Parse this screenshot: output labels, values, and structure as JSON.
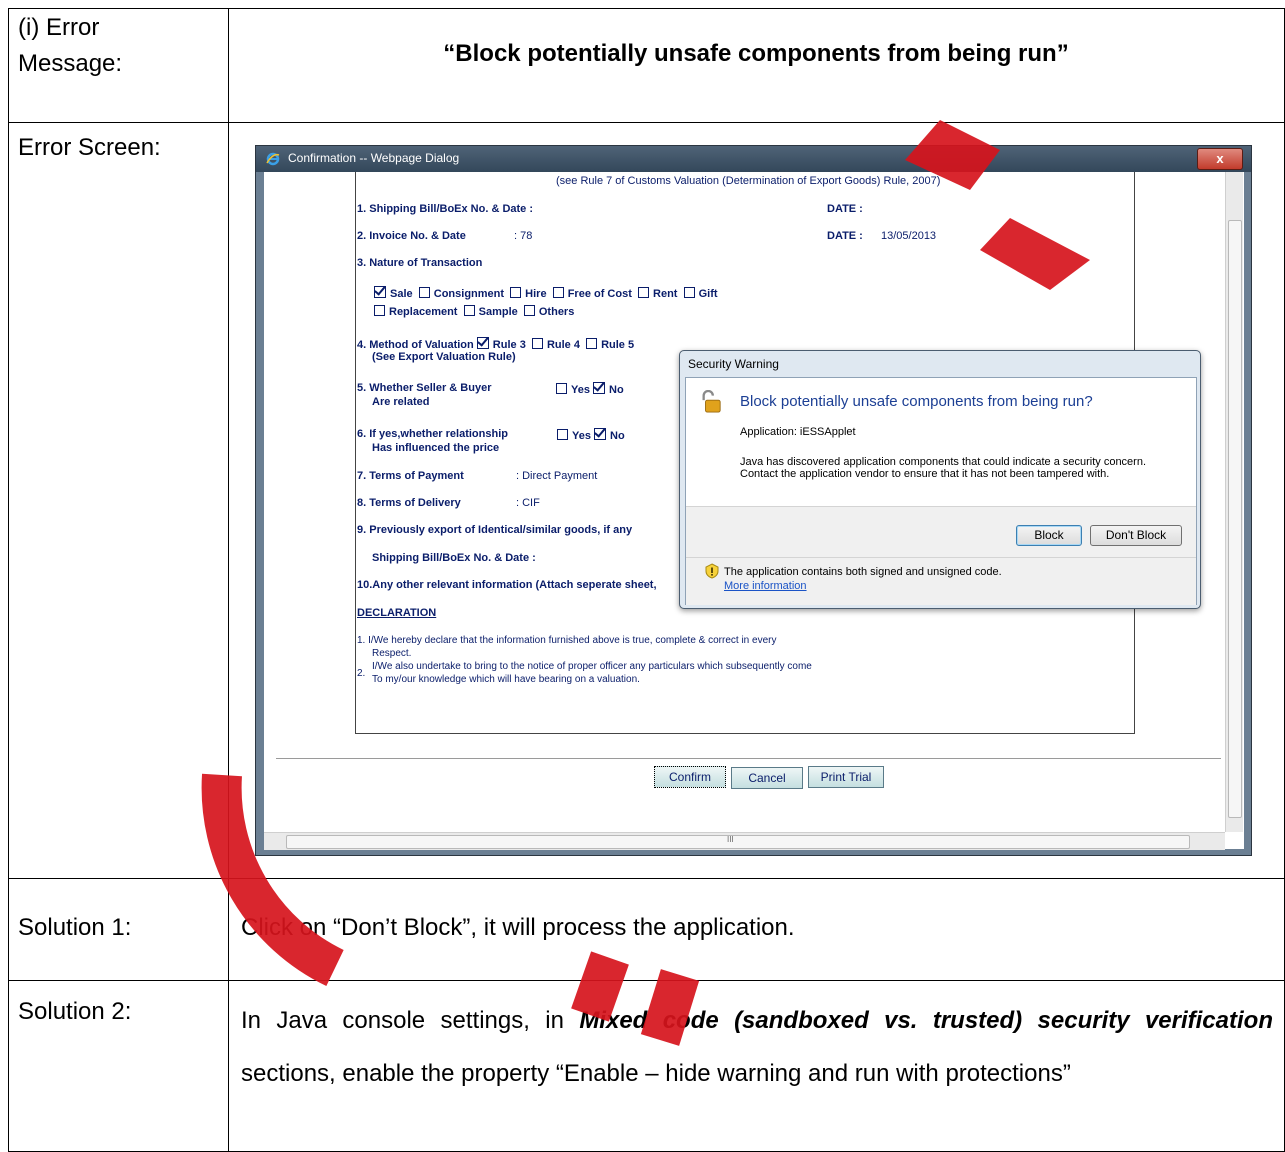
{
  "row1": {
    "label": "(i) Error Message:",
    "message": "“Block potentially unsafe components from being run”"
  },
  "row2": {
    "label": "Error Screen:"
  },
  "row3": {
    "label": "Solution 1:",
    "text": "Click on “Don’t Block”, it will process the application."
  },
  "row4": {
    "label": "Solution 2:",
    "text_pre": "In Java console settings, in ",
    "text_bold": "Mixed code (sandboxed vs. trusted) security verification",
    "text_post": " sections, enable the property “Enable – hide warning and run with protections”"
  },
  "window": {
    "title": "Confirmation -- Webpage Dialog",
    "close_label": "x",
    "close_icon": "close-icon",
    "browser_icon": "internet-explorer-icon"
  },
  "form": {
    "rule_header": "(see Rule 7 of Customs Valuation (Determination of Export Goods) Rule, 2007)",
    "item1": "1. Shipping Bill/BoEx No. & Date  :",
    "item1_date": "DATE :",
    "item2": "2. Invoice No. & Date",
    "item2_value": ": 78",
    "item2_date": "DATE :",
    "item2_date_value": "13/05/2013",
    "item3": "3. Nature of Transaction",
    "opt_sale": "Sale",
    "opt_consignment": "Consignment",
    "opt_hire": "Hire",
    "opt_free": "Free of Cost",
    "opt_rent": "Rent",
    "opt_gift": "Gift",
    "opt_replacement": "Replacement",
    "opt_sample": "Sample",
    "opt_others": "Others",
    "item4": "4. Method of Valuation",
    "rule3": "Rule 3",
    "rule4": "Rule 4",
    "rule5": "Rule 5",
    "item4_sub": "(See Export Valuation Rule)",
    "item5_line1": "5. Whether Seller & Buyer",
    "item5_line2": "Are related",
    "yes": "Yes",
    "no": "No",
    "item6_line1": "6. If yes,whether relationship",
    "item6_line2": "Has influenced the price",
    "item7": "7. Terms of Payment",
    "item7_value": ": Direct Payment",
    "item8": "8. Terms of Delivery",
    "item8_value": ": CIF",
    "item9": "9. Previously export of Identical/similar goods, if any",
    "item9_sub": "Shipping Bill/BoEx No. & Date :",
    "item10": "10.Any other relevant information (Attach seperate sheet,",
    "declaration": "DECLARATION",
    "decl1_line1": "1.  I/We hereby declare that the information furnished above is true, complete & correct in every",
    "decl1_line2": "Respect.",
    "decl2_line1": "I/We also undertake to bring to the notice of proper officer any particulars which subsequently come",
    "decl2_num": "2.",
    "decl2_line2": "To my/our knowledge which will have bearing on a valuation.",
    "confirm": "Confirm",
    "cancel": "Cancel",
    "print": "Print Trial",
    "hscroll_mark": "III"
  },
  "dialog": {
    "title": "Security Warning",
    "heading": "Block potentially unsafe components from being run?",
    "application": "Application: iESSApplet",
    "body": "Java has discovered application components that could indicate a security concern. Contact the application vendor to ensure that it has not been tampered with.",
    "block": "Block",
    "dont_block": "Don't Block",
    "warning": "The application contains both signed and unsigned code.",
    "more_info": "More information",
    "lock_icon": "unlocked-padlock-icon",
    "warn_icon": "warning-shield-icon"
  },
  "colors": {
    "watermark": "#d6141c",
    "form_text": "#0a1d6a",
    "dialog_heading": "#1c3f94"
  }
}
